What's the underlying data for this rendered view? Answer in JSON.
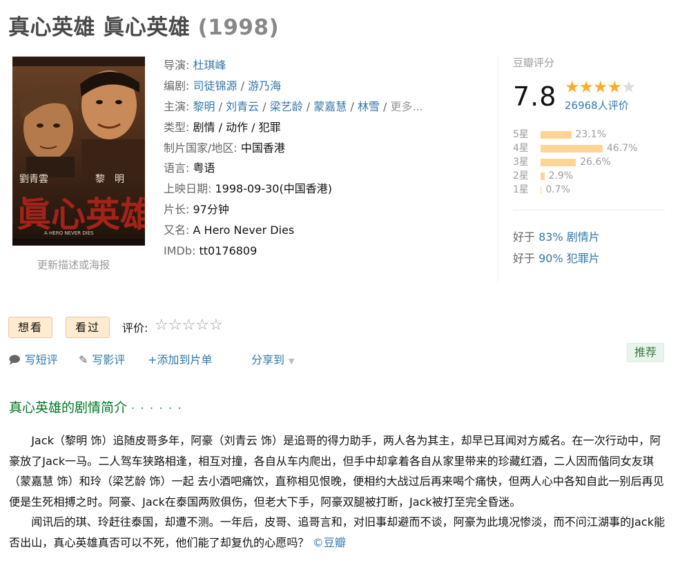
{
  "title": {
    "name": "真心英雄 眞心英雄",
    "year": "(1998)"
  },
  "poster": {
    "caption": "更新描述或海报"
  },
  "info": {
    "director_label": "导演:",
    "director": "杜琪峰",
    "writer_label": "编剧:",
    "writers": [
      "司徒锦源",
      "游乃海"
    ],
    "cast_label": "主演:",
    "cast": [
      "黎明",
      "刘青云",
      "梁艺龄",
      "蒙嘉慧",
      "林雪"
    ],
    "cast_more": "更多...",
    "genre_label": "类型:",
    "genres": "剧情 / 动作 / 犯罪",
    "country_label": "制片国家/地区:",
    "country": "中国香港",
    "language_label": "语言:",
    "language": "粤语",
    "release_label": "上映日期:",
    "release": "1998-09-30(中国香港)",
    "runtime_label": "片长:",
    "runtime": "97分钟",
    "aka_label": "又名:",
    "aka": "A Hero Never Dies",
    "imdb_label": "IMDb:",
    "imdb": "tt0176809"
  },
  "rating": {
    "label": "豆瓣评分",
    "score": "7.8",
    "stars_filled": 4,
    "votes": "26968人评价",
    "distribution": [
      {
        "label": "5星",
        "percent": "23.1%",
        "value": 23.1
      },
      {
        "label": "4星",
        "percent": "46.7%",
        "value": 46.7
      },
      {
        "label": "3星",
        "percent": "26.6%",
        "value": 26.6
      },
      {
        "label": "2星",
        "percent": "2.9%",
        "value": 2.9
      },
      {
        "label": "1星",
        "percent": "0.7%",
        "value": 0.7
      }
    ],
    "better_than": [
      {
        "prefix": "好于",
        "value": "83% 剧情片"
      },
      {
        "prefix": "好于",
        "value": "90% 犯罪片"
      }
    ]
  },
  "actions": {
    "want_label": "想看",
    "watched_label": "看过",
    "rate_label": "评价:",
    "short_review": "写短评",
    "review": "写影评",
    "add_list": "+添加到片单",
    "share": "分享到",
    "recommend": "推荐"
  },
  "summary": {
    "title": "真心英雄的剧情简介",
    "dots": "· · · · · ·",
    "paragraph1": "Jack（黎明 饰）追随皮哥多年，阿豪（刘青云 饰）是追哥的得力助手，两人各为其主，却早已耳闻对方威名。在一次行动中，阿豪放了Jack一马。二人驾车狭路相逢，相互对撞，各自从车内爬出，但手中却拿着各自从家里带来的珍藏红酒，二人因而偕同女友琪（蒙嘉慧 饰）和玲（梁艺龄 饰）一起 去小酒吧痛饮，直称相见恨晚，便相约大战过后再来喝个痛快，但两人心中各知自此一别后再见便是生死相搏之时。阿豪、Jack在泰国两败俱伤，但老大下手，阿豪双腿被打断，Jack被打至完全昏迷。",
    "paragraph2": "闻讯后的琪、玲赶往泰国，却遭不测。一年后，皮哥、追哥言和，对旧事却避而不谈，阿豪为此境况惨淡，而不问江湖事的Jack能否出山，真心英雄真否可以不死，他们能了却复仇的心愿吗？",
    "source": "©豆瓣"
  },
  "colors": {
    "link": "#3377aa",
    "star": "#ffac2d",
    "bar": "#ffd596",
    "green_heading": "#007722",
    "button_bg": "#ffebd0"
  }
}
